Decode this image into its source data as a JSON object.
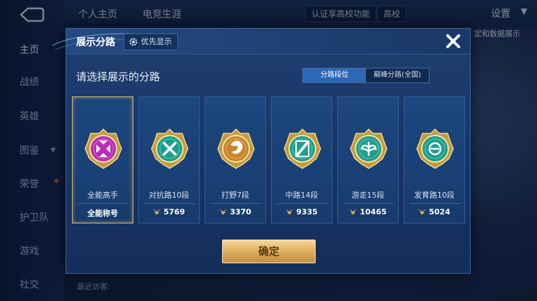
{
  "background": {
    "sidebar_items": [
      {
        "label": "主页",
        "active": true
      },
      {
        "label": "战绩"
      },
      {
        "label": "英雄"
      },
      {
        "label": "图鉴"
      },
      {
        "label": "荣誉"
      },
      {
        "label": "护卫队"
      },
      {
        "label": "游戏"
      },
      {
        "label": "社交"
      }
    ],
    "top_tabs": [
      "个人主页",
      "电竞生涯"
    ],
    "top_chip_1": "认证享高校功能",
    "top_chip_2": "高校",
    "settings_label": "设置",
    "right_edge_text": "定和数据展示",
    "bottom_text": "最近访客:"
  },
  "modal": {
    "title": "展示分路",
    "priority_label": "优先显示",
    "subtitle": "请选择展示的分路",
    "segments": [
      {
        "label": "分路段位",
        "active": true
      },
      {
        "label": "巅峰分路(全国)",
        "active": false
      }
    ],
    "cards": [
      {
        "name": "全能高手",
        "value": "全能称号",
        "selected": true,
        "emblem_color": "#b92bb8",
        "emblem": "omni-emblem",
        "show_value_icon": false
      },
      {
        "name": "对抗路10段",
        "value": "5769",
        "selected": false,
        "emblem_color": "#1c9f8e",
        "emblem": "clash-lane-emblem",
        "show_value_icon": true
      },
      {
        "name": "打野7段",
        "value": "3370",
        "selected": false,
        "emblem_color": "#c9862c",
        "emblem": "jungle-emblem",
        "show_value_icon": true
      },
      {
        "name": "中路14段",
        "value": "9335",
        "selected": false,
        "emblem_color": "#1c9f8e",
        "emblem": "mid-lane-emblem",
        "show_value_icon": true
      },
      {
        "name": "游走15段",
        "value": "10465",
        "selected": false,
        "emblem_color": "#1c9f8e",
        "emblem": "roam-emblem",
        "show_value_icon": true
      },
      {
        "name": "发育路10段",
        "value": "5024",
        "selected": false,
        "emblem_color": "#1c9f8e",
        "emblem": "farm-lane-emblem",
        "show_value_icon": true
      }
    ],
    "confirm_label": "确定"
  }
}
